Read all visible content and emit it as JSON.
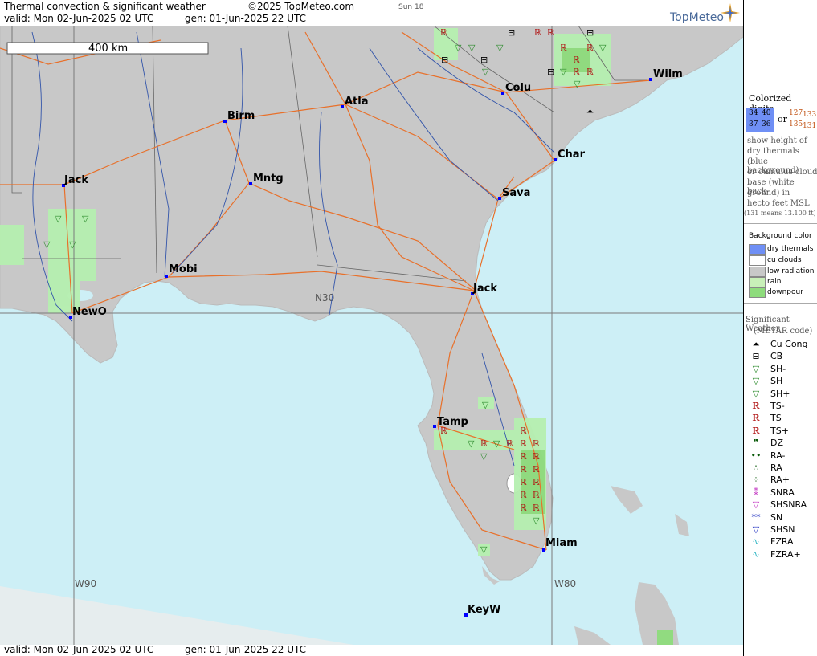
{
  "header": {
    "title": "Thermal convection & significant weather",
    "copyright": "©2025 TopMeteo.com",
    "sun": "Sun 18",
    "valid": "valid:  Mon  02-Jun-2025  02 UTC",
    "gen": "gen:  01-Jun-2025 22 UTC",
    "brand": "TopMeteo"
  },
  "footer": {
    "valid": "valid:  Mon  02-Jun-2025  02 UTC",
    "gen": "gen:  01-Jun-2025 22 UTC"
  },
  "map": {
    "scale": "400 km",
    "grid_labels": {
      "n30": "N30",
      "w90": "W90",
      "w80": "W80"
    },
    "cities": {
      "jack_ms": "Jack",
      "birm": "Birm",
      "atla": "Atla",
      "colu": "Colu",
      "wilm": "Wilm",
      "char": "Char",
      "mntg": "Mntg",
      "sava": "Sava",
      "mobi": "Mobi",
      "jack_fl": "Jack",
      "newo": "NewO",
      "tamp": "Tamp",
      "miam": "Miam",
      "keyw": "KeyW"
    },
    "colors": {
      "sea": "#cdeff6",
      "land": "#c8c8c8",
      "rain": "#b6f0b0",
      "downpour": "#8edc7c",
      "roads": "#e8702a",
      "rivers": "#3355aa"
    }
  },
  "legend": {
    "colorized_title": "Colorized digits",
    "digits_blue": [
      "34",
      "40",
      "37",
      "36"
    ],
    "or": "or",
    "digits_white": [
      "127",
      "133",
      "135",
      "131"
    ],
    "desc": [
      "show height of",
      "dry thermals",
      "(blue background)",
      "or cumulus cloud",
      "base (white back-",
      "ground) in",
      "hecto feet MSL",
      "(131 means 13.100 ft)"
    ],
    "bg_title": "Background color",
    "bg_items": [
      {
        "label": "dry thermals",
        "color": "#6f8ff5"
      },
      {
        "label": "cu clouds",
        "color": "#ffffff"
      },
      {
        "label": "low radiation",
        "color": "#c8c8c8"
      },
      {
        "label": "rain",
        "color": "#c8f0b8"
      },
      {
        "label": "downpour",
        "color": "#8edc7c"
      }
    ],
    "sig_title": "Significant Weather",
    "sig_sub": "(METAR code)",
    "sig_items": [
      {
        "label": "Cu Cong",
        "icon": "cu-cong-icon",
        "glyph": "⏶",
        "color": "#000"
      },
      {
        "label": "CB",
        "icon": "cb-icon",
        "glyph": "⊟",
        "color": "#000"
      },
      {
        "label": "SH-",
        "icon": "shower-light-icon",
        "glyph": "▽",
        "color": "#2a8a2a"
      },
      {
        "label": "SH",
        "icon": "shower-icon",
        "glyph": "▽",
        "color": "#2a8a2a"
      },
      {
        "label": "SH+",
        "icon": "shower-heavy-icon",
        "glyph": "▽",
        "color": "#2a8a2a"
      },
      {
        "label": "TS-",
        "icon": "thunderstorm-light-icon",
        "glyph": "ℝ",
        "color": "#b01010"
      },
      {
        "label": "TS",
        "icon": "thunderstorm-icon",
        "glyph": "ℝ",
        "color": "#b01010"
      },
      {
        "label": "TS+",
        "icon": "thunderstorm-heavy-icon",
        "glyph": "ℝ",
        "color": "#b01010"
      },
      {
        "label": "DZ",
        "icon": "drizzle-icon",
        "glyph": "❞",
        "color": "#0a5a0a"
      },
      {
        "label": "RA-",
        "icon": "rain-light-icon",
        "glyph": "••",
        "color": "#0a5a0a"
      },
      {
        "label": "RA",
        "icon": "rain-icon",
        "glyph": "∴",
        "color": "#0a5a0a"
      },
      {
        "label": "RA+",
        "icon": "rain-heavy-icon",
        "glyph": "⁘",
        "color": "#0a5a0a"
      },
      {
        "label": "SNRA",
        "icon": "snow-rain-icon",
        "glyph": "⁑",
        "color": "#c030c0"
      },
      {
        "label": "SHSNRA",
        "icon": "snow-rain-shower-icon",
        "glyph": "▽",
        "color": "#c030c0"
      },
      {
        "label": "SN",
        "icon": "snow-icon",
        "glyph": "**",
        "color": "#2030c0"
      },
      {
        "label": "SHSN",
        "icon": "snow-shower-icon",
        "glyph": "▽",
        "color": "#2030c0"
      },
      {
        "label": "FZRA",
        "icon": "freezing-rain-icon",
        "glyph": "∿",
        "color": "#20b0c0"
      },
      {
        "label": "FZRA+",
        "icon": "freezing-rain-heavy-icon",
        "glyph": "∿",
        "color": "#20b0c0"
      }
    ]
  }
}
